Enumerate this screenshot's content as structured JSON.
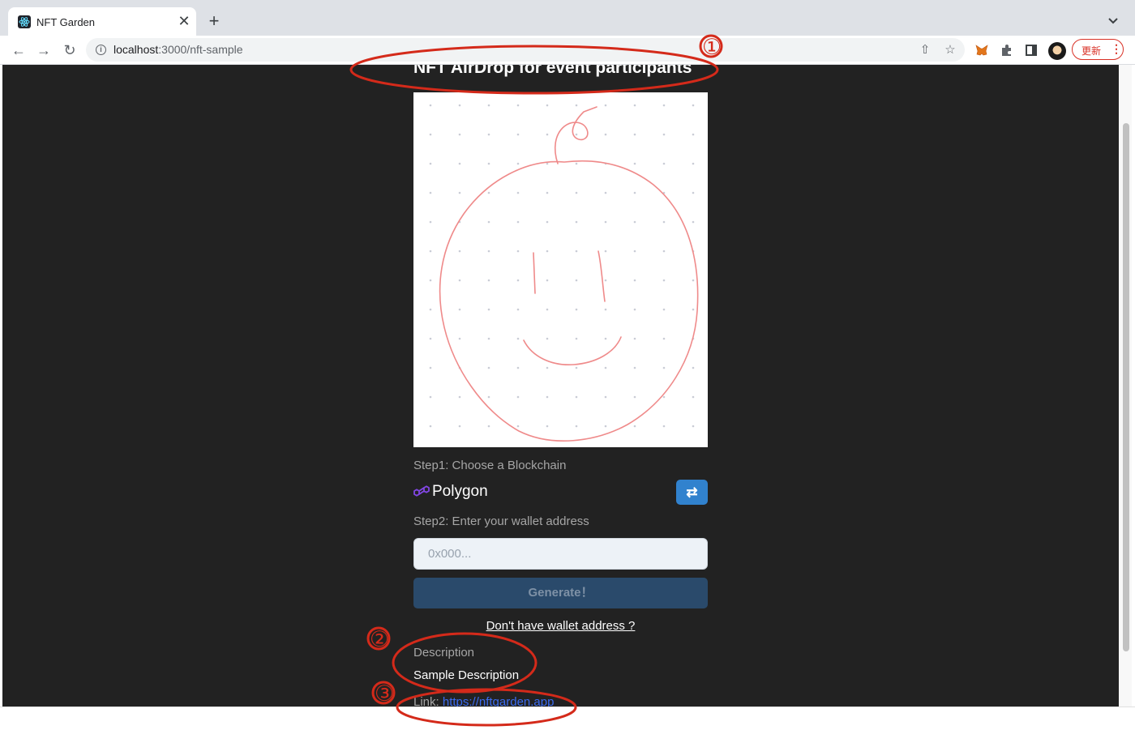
{
  "browser": {
    "tab_title": "NFT Garden",
    "url_host": "localhost",
    "url_rest": ":3000/nft-sample",
    "update_label": "更新",
    "tab_close_glyph": "✕",
    "new_tab_glyph": "+",
    "icons": [
      "tab-react-favicon",
      "back-arrow-icon",
      "forward-arrow-icon",
      "reload-icon",
      "site-info-icon",
      "share-icon",
      "bookmark-star-icon",
      "metamask-fox-icon",
      "extensions-puzzle-icon",
      "side-panel-icon",
      "profile-avatar",
      "kebab-menu-icon"
    ]
  },
  "page": {
    "title": "NFT AirDrop for event participants",
    "step1_label": "Step1: Choose a Blockchain",
    "chain_name": "Polygon",
    "step2_label": "Step2: Enter your wallet address",
    "wallet_placeholder": "0x000...",
    "generate_label": "Generate！",
    "no_wallet_link": "Don't have wallet address ?",
    "description_label": "Description",
    "description_value": "Sample Description",
    "link_label": "Link: ",
    "link_url": "https://nftgarden.app",
    "accent_color": "#3182ce",
    "background_color": "#222222"
  },
  "annotations": {
    "color": "#d42a1a",
    "markers": [
      "①",
      "②",
      "③"
    ]
  }
}
